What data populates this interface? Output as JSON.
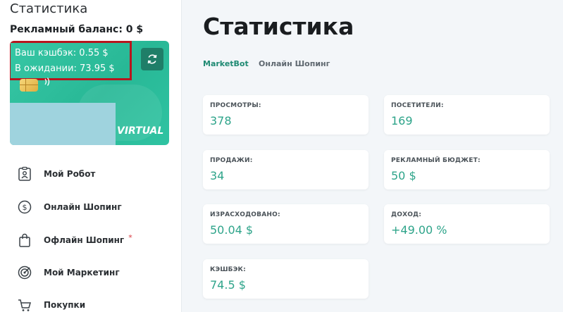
{
  "sidebar": {
    "title": "Статистика",
    "ad_balance": "Рекламный баланс: 0 $",
    "card": {
      "cashback": "Ваш кэшбэк: 0.55 $",
      "pending": "В ожидании: 73.95 $",
      "brand": "VIRTUAL"
    },
    "menu": [
      {
        "label": "Мой Робот",
        "icon": "robot-id-icon"
      },
      {
        "label": "Онлайн Шопинг",
        "icon": "dollar-circle-icon"
      },
      {
        "label": "Офлайн Шопинг",
        "icon": "shopping-bag-icon",
        "badge": "*"
      },
      {
        "label": "Мой Маркетинг",
        "icon": "target-icon"
      },
      {
        "label": "Покупки",
        "icon": "cart-icon"
      }
    ]
  },
  "main": {
    "title": "Статистика",
    "tabs": [
      "MarketBot",
      "Онлайн Шопинг"
    ],
    "stats": [
      {
        "label": "ПРОСМОТРЫ:",
        "value": "378"
      },
      {
        "label": "ПОСЕТИТЕЛИ:",
        "value": "169"
      },
      {
        "label": "ПРОДАЖИ:",
        "value": "34"
      },
      {
        "label": "РЕКЛАМНЫЙ БЮДЖЕТ:",
        "value": "50 $"
      },
      {
        "label": "ИЗРАСХОДОВАНО:",
        "value": "50.04 $"
      },
      {
        "label": "ДОХОД:",
        "value": "+49.00 %"
      },
      {
        "label": "КЭШБЭК:",
        "value": "74.5 $"
      }
    ]
  },
  "colors": {
    "accent": "#2ea48a",
    "card": "#2fbf9f",
    "highlight_border": "#b7161e"
  }
}
